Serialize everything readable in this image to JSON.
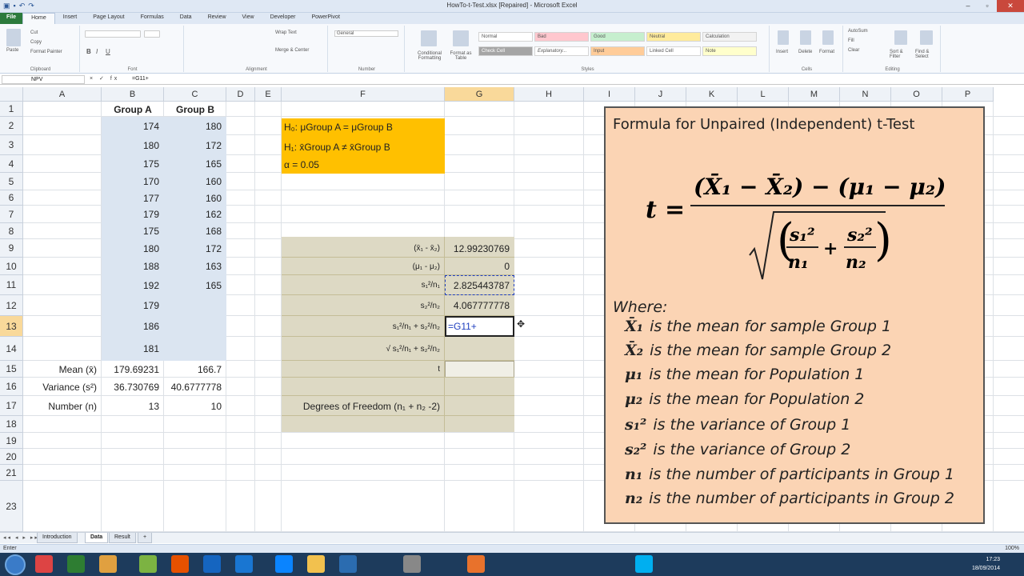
{
  "window": {
    "title": "HowTo-t-Test.xlsx [Repaired] - Microsoft Excel"
  },
  "ribbon": {
    "tabs": [
      "File",
      "Home",
      "Insert",
      "Page Layout",
      "Formulas",
      "Data",
      "Review",
      "View",
      "Developer",
      "PowerPivot"
    ],
    "clipboard": {
      "paste": "Paste",
      "cut": "Cut",
      "copy": "Copy",
      "format_painter": "Format Painter",
      "name": "Clipboard"
    },
    "font_group": "Font",
    "alignment": {
      "wrap": "Wrap Text",
      "merge": "Merge & Center",
      "name": "Alignment"
    },
    "number": {
      "format": "General",
      "name": "Number"
    },
    "styles": {
      "conditional": "Conditional Formatting",
      "format_table": "Format as Table",
      "cells": [
        "Normal",
        "Bad",
        "Good",
        "Neutral",
        "Calculation",
        "Check Cell",
        "Explanatory...",
        "Input",
        "Linked Cell",
        "Note"
      ],
      "name": "Styles"
    },
    "cells_group": {
      "insert": "Insert",
      "delete": "Delete",
      "format": "Format",
      "name": "Cells"
    },
    "editing": {
      "autosum": "AutoSum",
      "fill": "Fill",
      "clear": "Clear",
      "sort": "Sort & Filter",
      "find": "Find & Select",
      "name": "Editing"
    }
  },
  "formula_bar": {
    "name_box": "NPV",
    "icons": "× ✓ fx",
    "value": "=G11+"
  },
  "columns": [
    "A",
    "B",
    "C",
    "D",
    "E",
    "F",
    "G",
    "H",
    "I",
    "J",
    "K",
    "L",
    "M",
    "N",
    "O",
    "P"
  ],
  "rows": [
    "1",
    "2",
    "3",
    "4",
    "5",
    "6",
    "7",
    "8",
    "9",
    "10",
    "11",
    "12",
    "13",
    "14",
    "15",
    "16",
    "17",
    "18",
    "19",
    "20",
    "21",
    "23"
  ],
  "group_headers": {
    "a": "Group A",
    "b": "Group B"
  },
  "group_a": [
    "174",
    "180",
    "175",
    "170",
    "177",
    "179",
    "175",
    "180",
    "188",
    "192",
    "179",
    "186",
    "181"
  ],
  "group_b": [
    "180",
    "172",
    "165",
    "160",
    "160",
    "162",
    "168",
    "172",
    "163",
    "165"
  ],
  "stats": {
    "mean_label": "Mean (x̄)",
    "mean_a": "179.69231",
    "mean_b": "166.7",
    "variance_label": "Variance (s²)",
    "variance_a": "36.730769",
    "variance_b": "40.6777778",
    "number_label": "Number (n)",
    "number_a": "13",
    "number_b": "10"
  },
  "hypothesis": {
    "h0": "H₀: μGroup A = μGroup B",
    "h1": "H₁: x̄Group A ≠ x̄Group B",
    "alpha": "α = 0.05"
  },
  "calc": {
    "labels": [
      "(x̄₁ - x̄₂)",
      "(μ₁ - μ₂)",
      "s₁²/n₁",
      "s₂²/n₂",
      "s₁²/n₁ + s₂²/n₂",
      "√ s₁²/n₁ + s₂²/n₂",
      "t",
      "",
      "Degrees of Freedom (n₁ + n₂ -2)"
    ],
    "values": [
      "12.99230769",
      "0",
      "2.825443787",
      "4.067777778",
      "=G11+",
      "",
      "",
      "",
      ""
    ]
  },
  "panel": {
    "title": "Formula for Unpaired (Independent) t-Test",
    "where": "Where:",
    "definitions": [
      {
        "sym": "X̄₁",
        "text": "is the mean for sample Group 1"
      },
      {
        "sym": "X̄₂",
        "text": "is the mean for sample Group 2"
      },
      {
        "sym": "μ₁",
        "text": "is the mean for Population 1"
      },
      {
        "sym": "μ₂",
        "text": "is the mean for Population 2"
      },
      {
        "sym": "s₁²",
        "text": "is the variance of Group 1"
      },
      {
        "sym": "s₂²",
        "text": "is the variance of Group 2"
      },
      {
        "sym": "n₁",
        "text": "is the number of participants in Group 1"
      },
      {
        "sym": "n₂",
        "text": "is the number of participants in Group 2"
      }
    ]
  },
  "sheet_tabs": [
    "Introduction",
    "Data",
    "Result"
  ],
  "status": {
    "mode": "Enter",
    "zoom": "100%"
  },
  "taskbar": {
    "time": "17:23",
    "date": "18/09/2014"
  },
  "colors": {
    "accent": "#ffc000",
    "panel": "#fbd4b4",
    "blue_fill": "#dbe5f1",
    "tan_fill": "#ddd9c4"
  }
}
